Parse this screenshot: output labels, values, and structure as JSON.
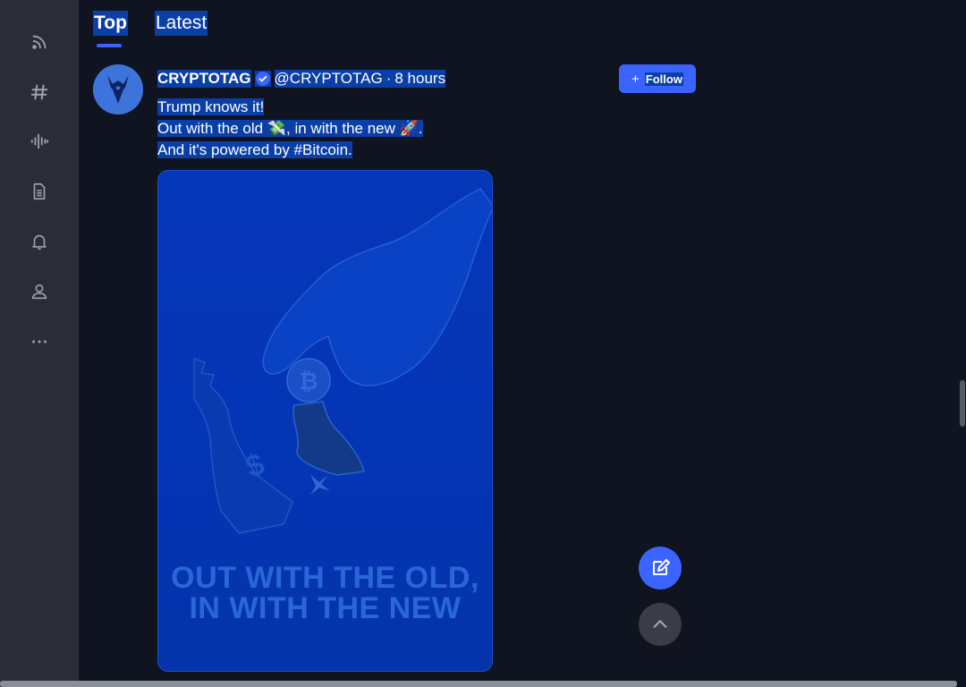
{
  "sidebar": {
    "icons": [
      "rss-icon",
      "hashtag-icon",
      "audio-wave-icon",
      "document-icon",
      "bell-icon",
      "user-icon",
      "more-icon"
    ]
  },
  "tabs": {
    "top": "Top",
    "latest": "Latest",
    "active": "Top"
  },
  "post": {
    "author": "CRYPTOTAG",
    "handle": "@CRYPTOTAG",
    "separator": "·",
    "time": "8 hours",
    "follow_label": "Follow",
    "lines": [
      "Trump knows it!",
      "Out with the old 💸, in with the new 🚀.",
      "And it's powered by #Bitcoin."
    ],
    "image_caption": [
      "OUT WITH THE OLD,",
      "IN WITH THE NEW"
    ]
  },
  "colors": {
    "accent": "#3b63ff",
    "selection": "#0b3fa8",
    "sidebar_bg": "#2a2d36",
    "main_bg": "#0f1420",
    "image_bg": "#0435b5"
  }
}
